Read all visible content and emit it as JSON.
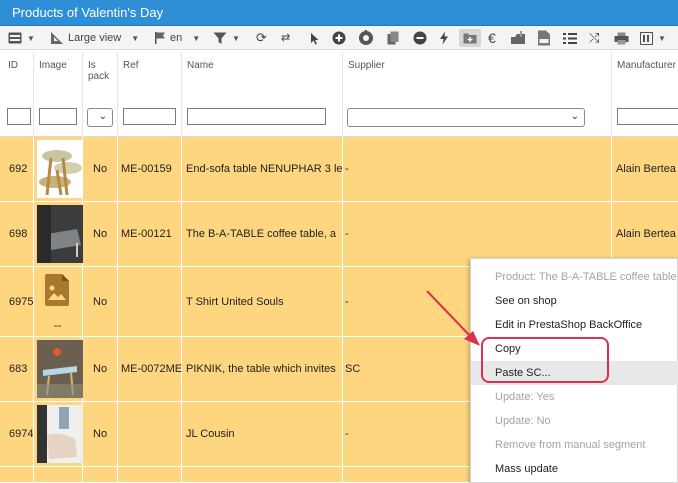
{
  "window": {
    "title": "Products of Valentin's Day"
  },
  "toolbar": {
    "view_label": "Large view",
    "lang_label": "en",
    "icons": [
      "grid-icon",
      "ruler-icon",
      "flag-icon",
      "filter-icon",
      "refresh-icon",
      "sync-icon",
      "cursor-icon",
      "add-icon",
      "grid-settings-icon",
      "duplicate-icon",
      "remove-icon",
      "lightning-icon",
      "folder-add-icon",
      "euro-icon",
      "export-icon",
      "csv-icon",
      "list-icon",
      "shuffle-icon",
      "print-icon",
      "columns-icon"
    ]
  },
  "columns": [
    "ID",
    "Image",
    "Is pack",
    "Ref",
    "Name",
    "Supplier",
    "Manufacturer"
  ],
  "rows": [
    {
      "id": "692",
      "pack": "No",
      "ref": "ME-00159",
      "name": "End-sofa table NENUPHAR 3 le",
      "supplier": "-",
      "manufacturer": "Alain Bertea"
    },
    {
      "id": "698",
      "pack": "No",
      "ref": "ME-00121",
      "name": "The B-A-TABLE coffee table, a",
      "supplier": "-",
      "manufacturer": "Alain Bertea"
    },
    {
      "id": "6975",
      "pack": "No",
      "ref": "",
      "name": "T Shirt United Souls",
      "supplier": "-",
      "manufacturer": "",
      "image_caption": "--"
    },
    {
      "id": "683",
      "pack": "No",
      "ref": "ME-0072ME",
      "name": "PIKNIK, the table which invites",
      "supplier": "SC",
      "manufacturer": ""
    },
    {
      "id": "6974",
      "pack": "No",
      "ref": "",
      "name": "JL Cousin",
      "supplier": "-",
      "manufacturer": ""
    }
  ],
  "context_menu": {
    "items": [
      {
        "label": "Product: The B-A-TABLE coffee table",
        "disabled": true
      },
      {
        "label": "See on shop",
        "disabled": false
      },
      {
        "label": "Edit in PrestaShop BackOffice",
        "disabled": false
      },
      {
        "label": "Copy",
        "disabled": false
      },
      {
        "label": "Paste SC...",
        "disabled": false
      },
      {
        "label": "Update: Yes",
        "disabled": true
      },
      {
        "label": "Update: No",
        "disabled": true
      },
      {
        "label": "Remove from manual segment",
        "disabled": true
      },
      {
        "label": "Mass update",
        "disabled": false
      }
    ]
  },
  "colors": {
    "title_bar": "#2e8fd6",
    "row_bg": "#fdd67f",
    "annotation": "#d8324e"
  }
}
